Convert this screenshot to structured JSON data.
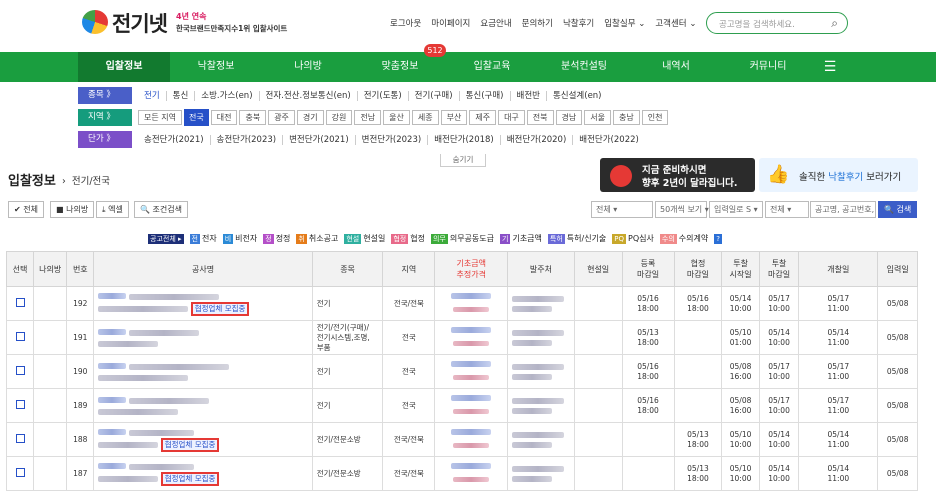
{
  "header": {
    "brand": "전기넷",
    "tagline1": "4년 연속",
    "tagline2": "한국브랜드만족지수1위 입찰사이트",
    "links": [
      "로그아웃",
      "마이페이지",
      "요금안내",
      "문의하기",
      "낙찰후기",
      "입찰실무 ⌄",
      "고객센터 ⌄"
    ],
    "search_placeholder": "공고명을 검색하세요."
  },
  "nav": {
    "items": [
      "입찰정보",
      "낙찰정보",
      "나의방",
      "맞춤정보",
      "입찰교육",
      "분석컨설팅",
      "내역서",
      "커뮤니티",
      "☰"
    ],
    "badge": "512"
  },
  "filters": {
    "type_label": "종목 》",
    "type_items": [
      "전기",
      "통신",
      "소방.가스(en)",
      "전자.전산.정보통신(en)",
      "전기(도통)",
      "전기(구매)",
      "통신(구매)",
      "배전반",
      "통신설계(en)"
    ],
    "region_label": "지역 》",
    "region_items": [
      "모든 지역",
      "전국",
      "대전",
      "충북",
      "광주",
      "경기",
      "강원",
      "전남",
      "울산",
      "세종",
      "부산",
      "제주",
      "대구",
      "전북",
      "경남",
      "서울",
      "충남",
      "인천"
    ],
    "price_label": "단가 》",
    "price_items": [
      "송전단가(2021)",
      "송전단가(2023)",
      "변전단가(2021)",
      "변전단가(2023)",
      "배전단가(2018)",
      "배전단가(2020)",
      "배전단가(2022)"
    ],
    "collapse": "숨기기"
  },
  "page": {
    "title": "입찰정보",
    "crumb": "전기/전국"
  },
  "banners": {
    "ad1_line1": "지금 준비하시면",
    "ad1_line2": "향후 2년이 달라집니다.",
    "ad2_pre": "솔직한 ",
    "ad2_hl": "낙찰후기",
    "ad2_post": " 보러가기"
  },
  "toolbar": {
    "all": "✔ 전체",
    "myroom": "■ 나의방",
    "excel": "⤓ 엑셀",
    "condition": "🔍 조건검색",
    "sel1": "전체 ▾",
    "sel2": "50개씩 보기 ▾",
    "sel3": "입력일로 S ▾",
    "sel4": "전체 ▾",
    "search_ph": "공고명, 공고번호, 발",
    "go": "🔍 검색"
  },
  "legend": [
    {
      "badge": "공고전체 ▸",
      "color": "#1d2f78",
      "text": ""
    },
    {
      "badge": "전",
      "color": "#3b7dd8",
      "text": "전자"
    },
    {
      "badge": "비",
      "color": "#2b8ad6",
      "text": "비전자"
    },
    {
      "badge": "정",
      "color": "#b44fc8",
      "text": "정정"
    },
    {
      "badge": "취",
      "color": "#e57c1a",
      "text": "취소공고"
    },
    {
      "badge": "현설",
      "color": "#2fb0a0",
      "text": "현설일"
    },
    {
      "badge": "협정",
      "color": "#e86a8a",
      "text": "협정"
    },
    {
      "badge": "의무",
      "color": "#3cab3a",
      "text": "의무공동도급"
    },
    {
      "badge": "기",
      "color": "#8a4fc8",
      "text": "기초금액"
    },
    {
      "badge": "특허",
      "color": "#6a6ad8",
      "text": "특허/신기술"
    },
    {
      "badge": "PQ",
      "color": "#c8a82b",
      "text": "PQ심사"
    },
    {
      "badge": "수의",
      "color": "#f08a8a",
      "text": "수의계약"
    },
    {
      "badge": "?",
      "color": "#2b6fd6",
      "text": ""
    }
  ],
  "table": {
    "headers": [
      "선택",
      "나의방",
      "번호",
      "공사명",
      "종목",
      "지역",
      "기초금액\n추정가격",
      "발주처",
      "현설일",
      "등록\n마감일",
      "협정\n마감일",
      "투찰\n시작일",
      "투찰\n마감일",
      "개찰일",
      "입력일"
    ],
    "rows": [
      {
        "no": "192",
        "tag": "협정업체 모집중",
        "type": "전기",
        "region": "전국/전북",
        "reg": "05/16\n18:00",
        "agree": "05/16\n18:00",
        "bstart": "05/14\n10:00",
        "bend": "05/17\n10:00",
        "open": "05/17\n11:00",
        "input": "05/08"
      },
      {
        "no": "191",
        "tag": "",
        "type": "전기/전기(구매)/\n전기시스템,조명,\n부품",
        "region": "전국",
        "reg": "05/13\n18:00",
        "agree": "",
        "bstart": "05/10\n01:00",
        "bend": "05/14\n10:00",
        "open": "05/14\n11:00",
        "input": "05/08"
      },
      {
        "no": "190",
        "tag": "",
        "type": "전기",
        "region": "전국",
        "reg": "05/16\n18:00",
        "agree": "",
        "bstart": "05/08\n16:00",
        "bend": "05/17\n10:00",
        "open": "05/17\n11:00",
        "input": "05/08"
      },
      {
        "no": "189",
        "tag": "",
        "type": "전기",
        "region": "전국",
        "reg": "05/16\n18:00",
        "agree": "",
        "bstart": "05/08\n16:00",
        "bend": "05/17\n10:00",
        "open": "05/17\n11:00",
        "input": "05/08"
      },
      {
        "no": "188",
        "tag": "협정업체 모집중",
        "type": "전기/전문소방",
        "region": "전국/전북",
        "reg": "",
        "agree": "05/13\n18:00",
        "bstart": "05/10\n10:00",
        "bend": "05/14\n10:00",
        "open": "05/14\n11:00",
        "input": "05/08"
      },
      {
        "no": "187",
        "tag": "협정업체 모집중",
        "type": "전기/전문소방",
        "region": "전국/전북",
        "reg": "",
        "agree": "05/13\n18:00",
        "bstart": "05/10\n10:00",
        "bend": "05/14\n10:00",
        "open": "05/14\n11:00",
        "input": "05/08"
      }
    ]
  },
  "colors": {
    "nav_green": "#1a9e3f",
    "accent_blue": "#2650c8",
    "tag_red": "#e53935"
  }
}
